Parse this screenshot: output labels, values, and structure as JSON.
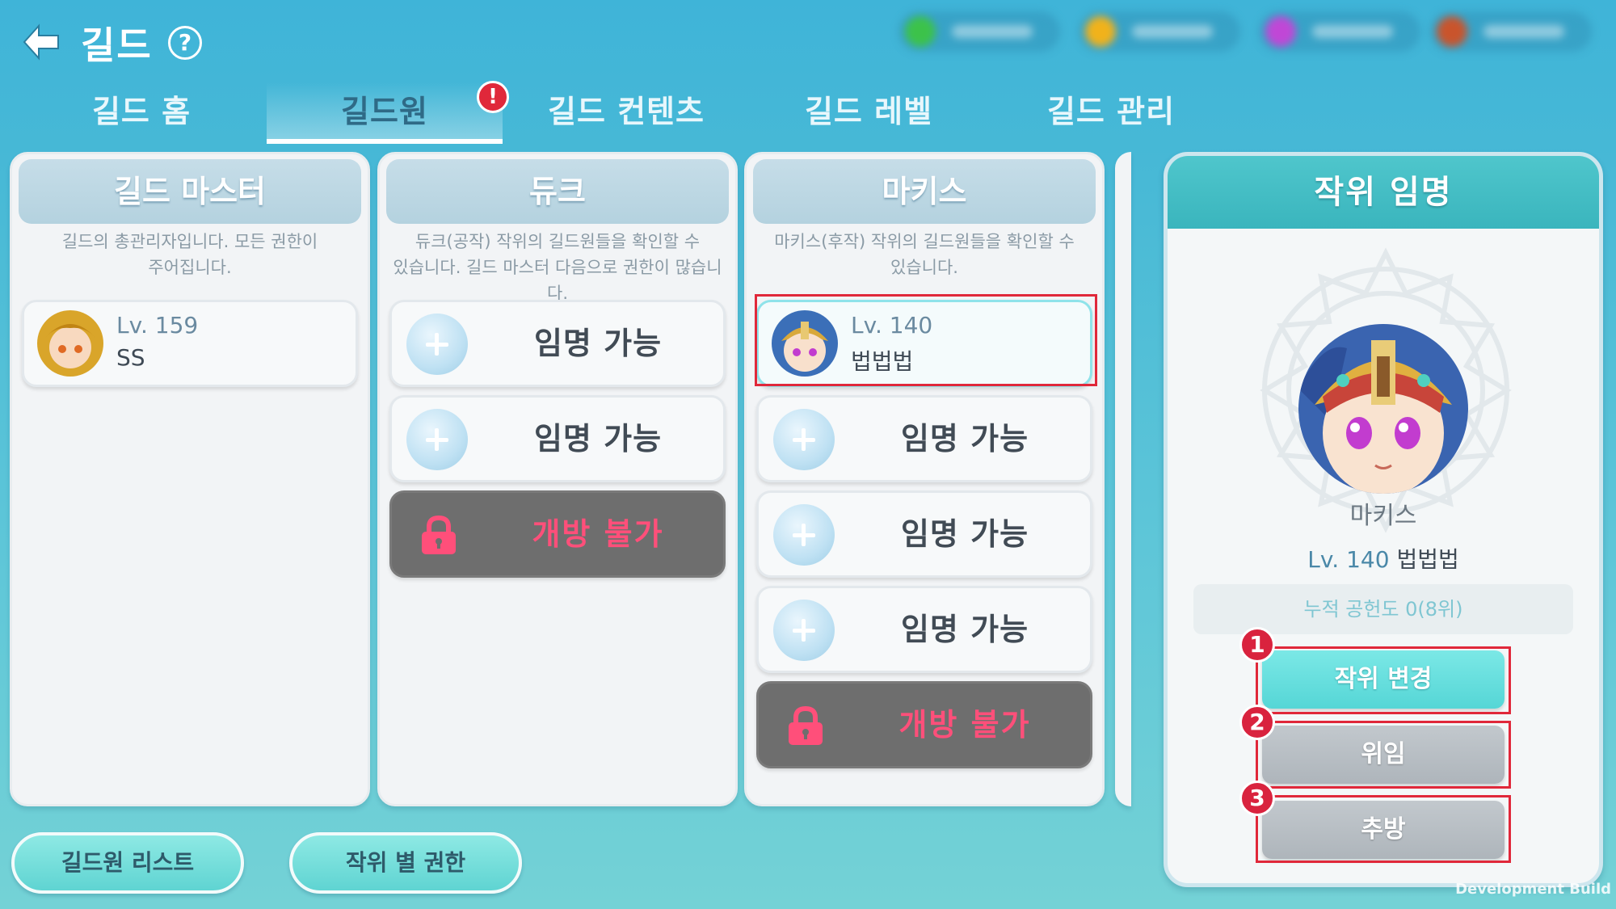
{
  "header": {
    "title": "길드",
    "help": "?"
  },
  "currencies": [
    {
      "color": "#3cc24a"
    },
    {
      "color": "#f1b21b"
    },
    {
      "color": "#c047d6"
    },
    {
      "color": "#c9542c"
    }
  ],
  "tabs": [
    {
      "label": "길드 홈",
      "active": false
    },
    {
      "label": "길드원",
      "active": true
    },
    {
      "label": "길드 컨텐츠",
      "active": false
    },
    {
      "label": "길드 레벨",
      "active": false
    },
    {
      "label": "길드 관리",
      "active": false
    }
  ],
  "tab_badge": "!",
  "columns": [
    {
      "title": "길드 마스터",
      "desc_line1": "길드의 총관리자입니다. 모든 권한이",
      "desc_line2": "주어집니다.",
      "slots": [
        {
          "type": "member",
          "level": "Lv. 159",
          "name": "SS"
        }
      ]
    },
    {
      "title": "듀크",
      "desc_line1": "듀크(공작) 작위의 길드원들을 확인할 수",
      "desc_line2": "있습니다. 길드 마스터 다음으로 권한이 많습니다.",
      "slots": [
        {
          "type": "open",
          "label": "임명 가능"
        },
        {
          "type": "open",
          "label": "임명 가능"
        },
        {
          "type": "locked",
          "label": "개방 불가"
        }
      ]
    },
    {
      "title": "마키스",
      "desc_line1": "마키스(후작) 작위의 길드원들을 확인할 수",
      "desc_line2": "있습니다.",
      "slots": [
        {
          "type": "member",
          "level": "Lv. 140",
          "name": "법법법",
          "selected": true
        },
        {
          "type": "open",
          "label": "임명 가능"
        },
        {
          "type": "open",
          "label": "임명 가능"
        },
        {
          "type": "open",
          "label": "임명 가능"
        },
        {
          "type": "locked",
          "label": "개방 불가"
        }
      ]
    }
  ],
  "bottom_buttons": {
    "member_list": "길드원 리스트",
    "rank_permissions": "작위 별 권한"
  },
  "panel": {
    "title": "작위 임명",
    "rank": "마키스",
    "level": "Lv. 140",
    "name": "법법법",
    "contribution": "누적 공헌도 0(8위)",
    "buttons": {
      "change_rank": "작위 변경",
      "delegate": "위임",
      "expel": "추방"
    },
    "badges": [
      "1",
      "2",
      "3"
    ]
  },
  "dev_build": "Development Build"
}
